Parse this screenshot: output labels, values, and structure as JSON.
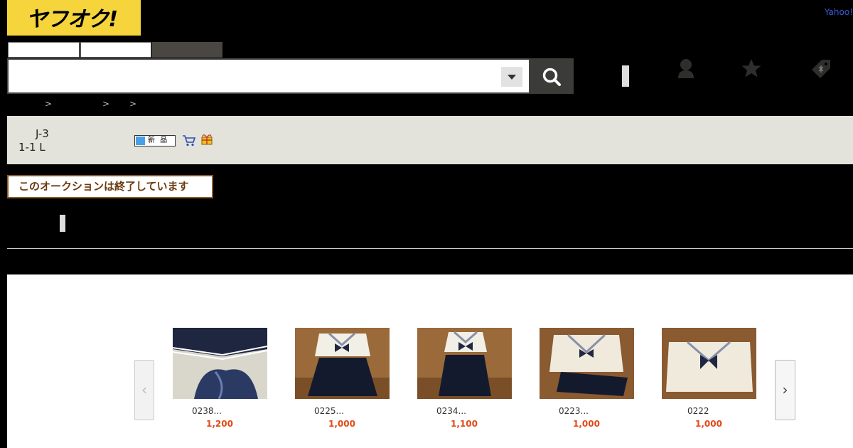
{
  "header": {
    "logo_text": "ヤフオク!",
    "yahoo_link": "Yahoo!",
    "search": {
      "value": "",
      "placeholder": ""
    },
    "breadcrumb_separators": [
      ">",
      ">",
      ">"
    ]
  },
  "item": {
    "title_line1": "J-3",
    "title_line2": "1-1 L",
    "badge_new": "新 品",
    "ended_notice": "このオークションは終了しています"
  },
  "related": {
    "items": [
      {
        "title": "0238...",
        "price": "1,200"
      },
      {
        "title": "0225...",
        "price": "1,000"
      },
      {
        "title": "0234...",
        "price": "1,100"
      },
      {
        "title": "0223...",
        "price": "1,000"
      },
      {
        "title": "0222",
        "price": "1,000"
      }
    ]
  },
  "colors": {
    "logo_bg": "#f5d53b",
    "price": "#e24a1a",
    "header_band": "#e3e2db",
    "notice_border": "#8a5a2b"
  },
  "icons": [
    "search-icon",
    "chevron-down-icon",
    "user-icon",
    "star-icon",
    "tag-icon",
    "cart-icon",
    "gift-icon",
    "chevron-left-icon",
    "chevron-right-icon"
  ]
}
